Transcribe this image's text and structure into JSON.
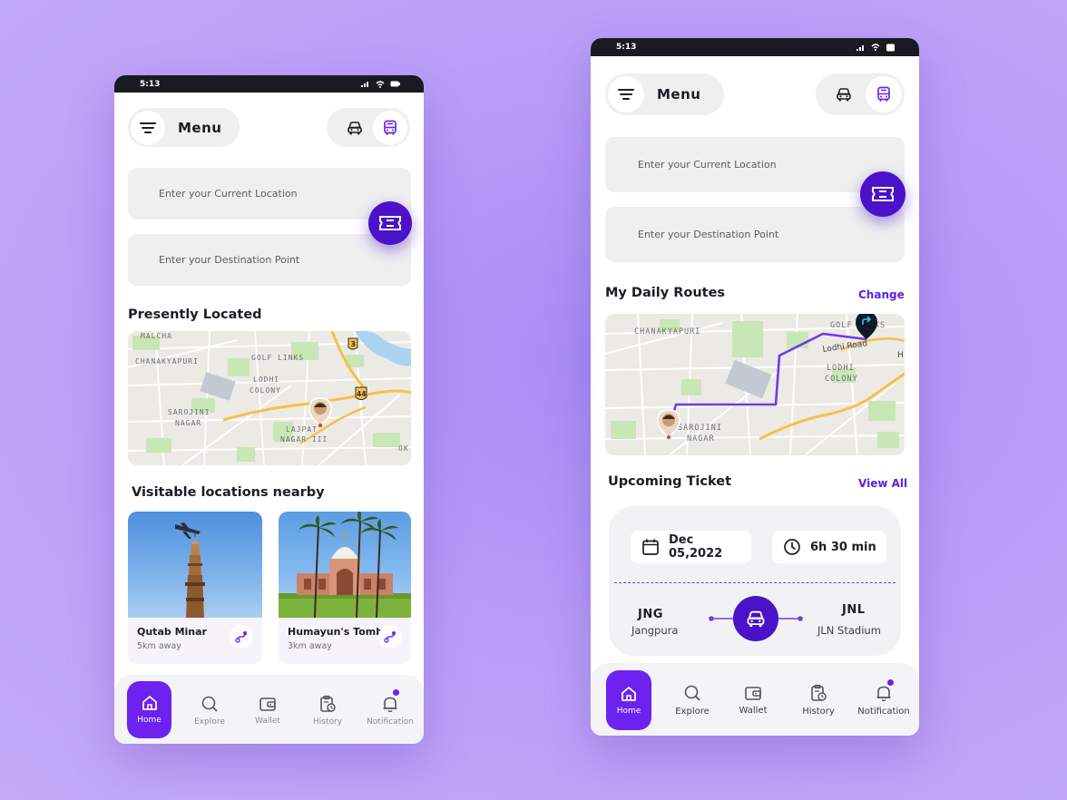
{
  "colors": {
    "accent": "#6d22f0",
    "fab": "#4a12c9",
    "route_line": "#6f3ce6"
  },
  "left": {
    "status_time": "5:13",
    "menu_label": "Menu",
    "current_location_placeholder": "Enter your Current Location",
    "destination_placeholder": "Enter your Destination Point",
    "presently_located_title": "Presently Located",
    "map_labels": [
      "MALCHA",
      "CHANAKYAPURI",
      "GOLF LINKS",
      "LODHI",
      "COLONY",
      "SAROJINI",
      "NAGAR",
      "LAJPAT",
      "NAGAR III",
      "OK",
      "3",
      "44"
    ],
    "nearby_title": "Visitable locations nearby",
    "places": [
      {
        "name": "Qutab Minar",
        "distance": "5km away"
      },
      {
        "name": "Humayun's Tomb",
        "distance": "3km away"
      }
    ],
    "nav": [
      {
        "label": "Home",
        "icon": "home-icon"
      },
      {
        "label": "Explore",
        "icon": "search-icon"
      },
      {
        "label": "Wallet",
        "icon": "wallet-icon"
      },
      {
        "label": "History",
        "icon": "history-icon"
      },
      {
        "label": "Notification",
        "icon": "bell-icon"
      }
    ]
  },
  "right": {
    "status_time": "5:13",
    "menu_label": "Menu",
    "current_location_placeholder": "Enter your Current Location",
    "destination_placeholder": "Enter your Destination Point",
    "daily_routes_title": "My Daily Routes",
    "change_link": "Change",
    "map_labels": [
      "CHANAKYAPURI",
      "GOLF LINKS",
      "Lodhi Road",
      "LODHI",
      "COLONY",
      "SAROJINI",
      "NAGAR",
      "H"
    ],
    "upcoming_title": "Upcoming Ticket",
    "view_all_link": "View All",
    "ticket": {
      "date": "Dec 05,2022",
      "duration": "6h 30 min",
      "from_code": "JNG",
      "from_name": "Jangpura",
      "to_code": "JNL",
      "to_name": "JLN Stadium"
    },
    "nav": [
      {
        "label": "Home",
        "icon": "home-icon"
      },
      {
        "label": "Explore",
        "icon": "search-icon"
      },
      {
        "label": "Wallet",
        "icon": "wallet-icon"
      },
      {
        "label": "History",
        "icon": "history-icon"
      },
      {
        "label": "Notification",
        "icon": "bell-icon"
      }
    ]
  }
}
